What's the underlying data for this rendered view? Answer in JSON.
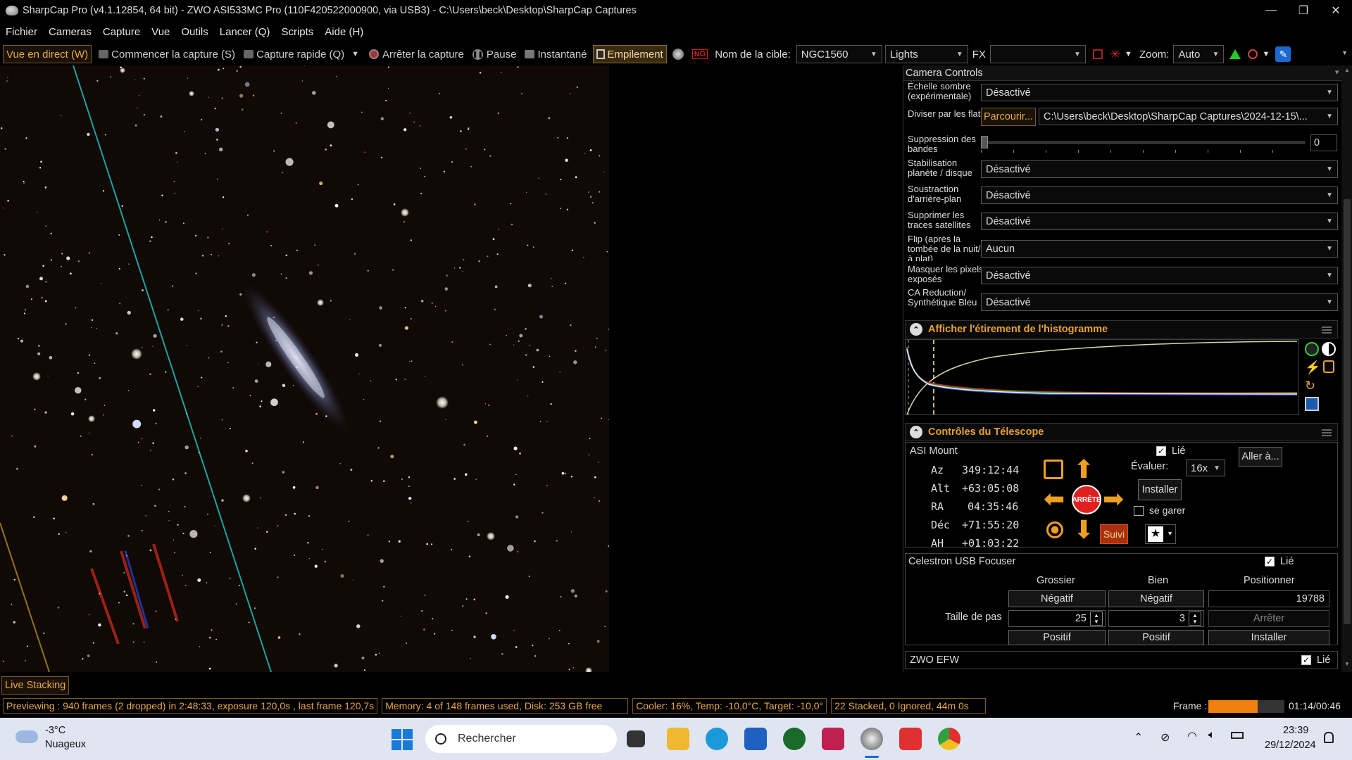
{
  "window": {
    "title": "SharpCap Pro (v4.1.12854, 64 bit) - ZWO ASI533MC Pro (110F420522000900, via USB3) - C:\\Users\\beck\\Desktop\\SharpCap Captures"
  },
  "menu": [
    "Fichier",
    "Cameras",
    "Capture",
    "Vue",
    "Outils",
    "Lancer (Q)",
    "Scripts",
    "Aide (H)"
  ],
  "toolbar": {
    "live_view": "Vue en direct (W)",
    "start_capture": "Commencer la capture (S)",
    "quick_capture": "Capture rapide (Q)",
    "stop_capture": "Arrêter la capture",
    "pause": "Pause",
    "snapshot": "Instantané",
    "stacking": "Empilement",
    "target_label": "Nom de la cible:",
    "target_value": "NGC1560",
    "frame_type": "Lights",
    "fx_label": "FX",
    "fx_value": "",
    "zoom_label": "Zoom:",
    "zoom_value": "Auto"
  },
  "camera_controls": {
    "title": "Camera Controls",
    "rows": [
      {
        "label": "Échelle sombre (expérimentale)",
        "value": "Désactivé"
      },
      {
        "label": "Diviser par les flats",
        "button": "Parcourir...",
        "value": "C:\\Users\\beck\\Desktop\\SharpCap Captures\\2024-12-15\\..."
      },
      {
        "label": "Suppression des bandes",
        "value": "0"
      },
      {
        "label": "Stabilisation planète / disque",
        "value": "Désactivé"
      },
      {
        "label": "Soustraction d'arrière-plan",
        "value": "Désactivé"
      },
      {
        "label": "Supprimer les traces satellites",
        "value": "Désactivé"
      },
      {
        "label": "Flip (après la tombée de la nuit/à plat)",
        "value": "Aucun"
      },
      {
        "label": "Masquer les pixels exposés",
        "value": "Désactivé"
      },
      {
        "label": "CA Reduction/ Synthétique Bleu",
        "value": "Désactivé"
      }
    ]
  },
  "histogram": {
    "title": "Afficher l'étirement de l'histogramme"
  },
  "telescope": {
    "title": "Contrôles du Télescope",
    "mount_name": "ASI Mount",
    "linked_label": "Lié",
    "coords": [
      {
        "label": "Az",
        "value": "349:12:44"
      },
      {
        "label": "Alt",
        "value": "+63:05:08"
      },
      {
        "label": "RA",
        "value": "04:35:46"
      },
      {
        "label": "Déc",
        "value": "+71:55:20"
      },
      {
        "label": "AH",
        "value": "+01:03:22"
      }
    ],
    "stop_label": "ARRÊTE",
    "rate_label": "Évaluer:",
    "rate_value": "16x",
    "install_label": "Installer",
    "park_label": "se garer",
    "tracking_label": "Suivi",
    "goto_label": "Aller à..."
  },
  "focuser": {
    "name": "Celestron USB Focuser",
    "linked_label": "Lié",
    "col_coarse": "Grossier",
    "col_fine": "Bien",
    "col_position": "Positionner",
    "negative": "Négatif",
    "positive": "Positif",
    "step_label": "Taille de pas",
    "coarse_step": "25",
    "fine_step": "3",
    "position_value": "19788",
    "stop": "Arrêter",
    "install": "Installer"
  },
  "efw": {
    "name": "ZWO EFW",
    "linked_label": "Lié"
  },
  "live_stacking_tab": "Live Stacking",
  "status": {
    "preview": "Previewing : 940 frames (2 dropped) in 2:48:33, exposure 120,0s , last frame 120,7s",
    "memory": "Memory: 4 of 148 frames used, Disk: 253 GB free",
    "cooler": "Cooler: 16%, Temp: -10,0°C, Target: -10,0°",
    "stacked": "22 Stacked, 0 Ignored, 44m 0s",
    "frame_label": "Frame :",
    "frame_progress": 0.65,
    "frame_time": "01:14/00:46"
  },
  "taskbar": {
    "temp": "-3°C",
    "weather": "Nuageux",
    "search": "Rechercher",
    "time": "23:39",
    "date": "29/12/2024"
  },
  "colors": {
    "accent": "#e8a030",
    "stop_red": "#e02020",
    "arrow_orange": "#f0a020",
    "progress": "#f08010"
  }
}
